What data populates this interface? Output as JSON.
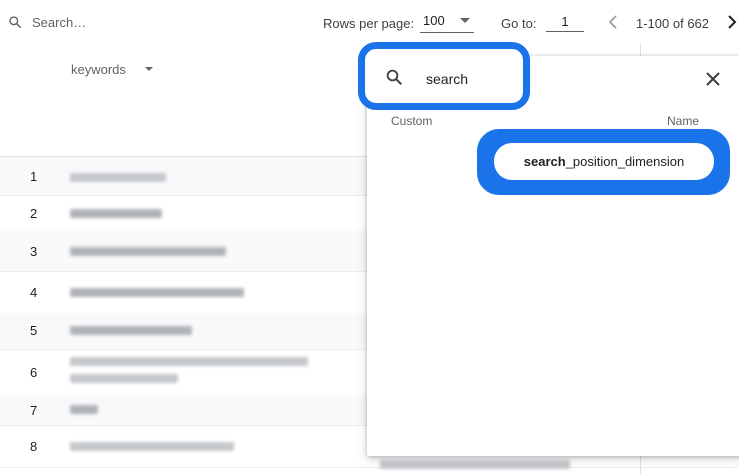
{
  "toolbar": {
    "search_placeholder": "Search…",
    "rows_per_page_label": "Rows per page:",
    "rows_per_page_value": "100",
    "go_to_label": "Go to:",
    "go_to_value": "1",
    "range_text": "1-100 of 662"
  },
  "table": {
    "column_header": "keywords",
    "row_numbers": [
      "1",
      "2",
      "3",
      "4",
      "5",
      "6",
      "7",
      "8"
    ]
  },
  "panel": {
    "search_value": "search",
    "custom_column_label": "Custom",
    "name_column_label": "Name",
    "result": {
      "match": "search",
      "rest": "_position_dimension"
    }
  },
  "colors": {
    "highlight": "#1a73e8",
    "alt_row": "#f8f9fa"
  }
}
